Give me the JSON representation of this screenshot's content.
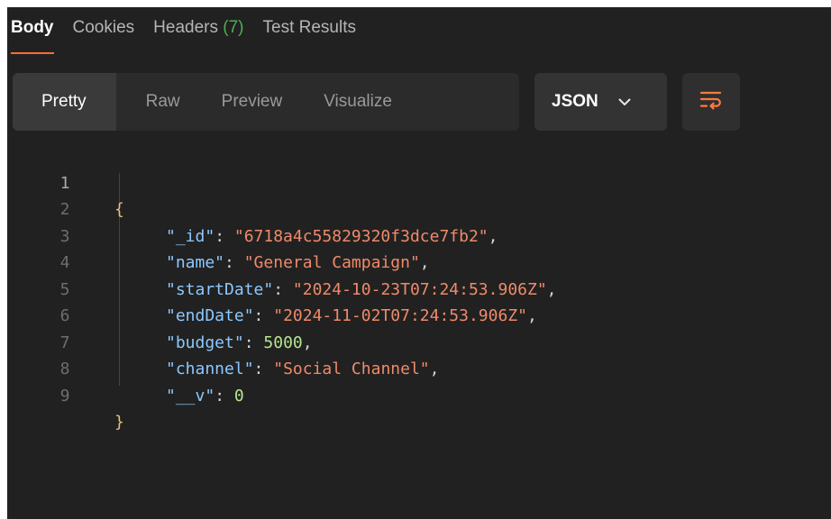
{
  "tabs": [
    {
      "label": "Body",
      "count": ""
    },
    {
      "label": "Cookies",
      "count": ""
    },
    {
      "label": "Headers",
      "count": "(7)"
    },
    {
      "label": "Test Results",
      "count": ""
    }
  ],
  "view_modes": [
    "Pretty",
    "Raw",
    "Preview",
    "Visualize"
  ],
  "format": {
    "selected": "JSON"
  },
  "code": {
    "open_brace": "{",
    "close_brace": "}",
    "line_numbers": [
      "1",
      "2",
      "3",
      "4",
      "5",
      "6",
      "7",
      "8",
      "9"
    ],
    "entries": [
      {
        "key": "\"_id\"",
        "value": "\"6718a4c55829320f3dce7fb2\"",
        "comma": ","
      },
      {
        "key": "\"name\"",
        "value": "\"General Campaign\"",
        "comma": ","
      },
      {
        "key": "\"startDate\"",
        "value": "\"2024-10-23T07:24:53.906Z\"",
        "comma": ","
      },
      {
        "key": "\"endDate\"",
        "value": "\"2024-11-02T07:24:53.906Z\"",
        "comma": ","
      },
      {
        "key": "\"budget\"",
        "value": "5000",
        "comma": ","
      },
      {
        "key": "\"channel\"",
        "value": "\"Social Channel\"",
        "comma": ","
      },
      {
        "key": "\"__v\"",
        "value": "0",
        "comma": ""
      }
    ]
  },
  "colors": {
    "accent": "#ff6c37",
    "count_green": "#4caf50",
    "key_blue": "#8cc8ff",
    "string_orange": "#f08a6a",
    "number_green": "#b5e68f"
  },
  "icons": {
    "wrap": "wrap-lines-icon",
    "dropdown": "chevron-down-icon"
  }
}
